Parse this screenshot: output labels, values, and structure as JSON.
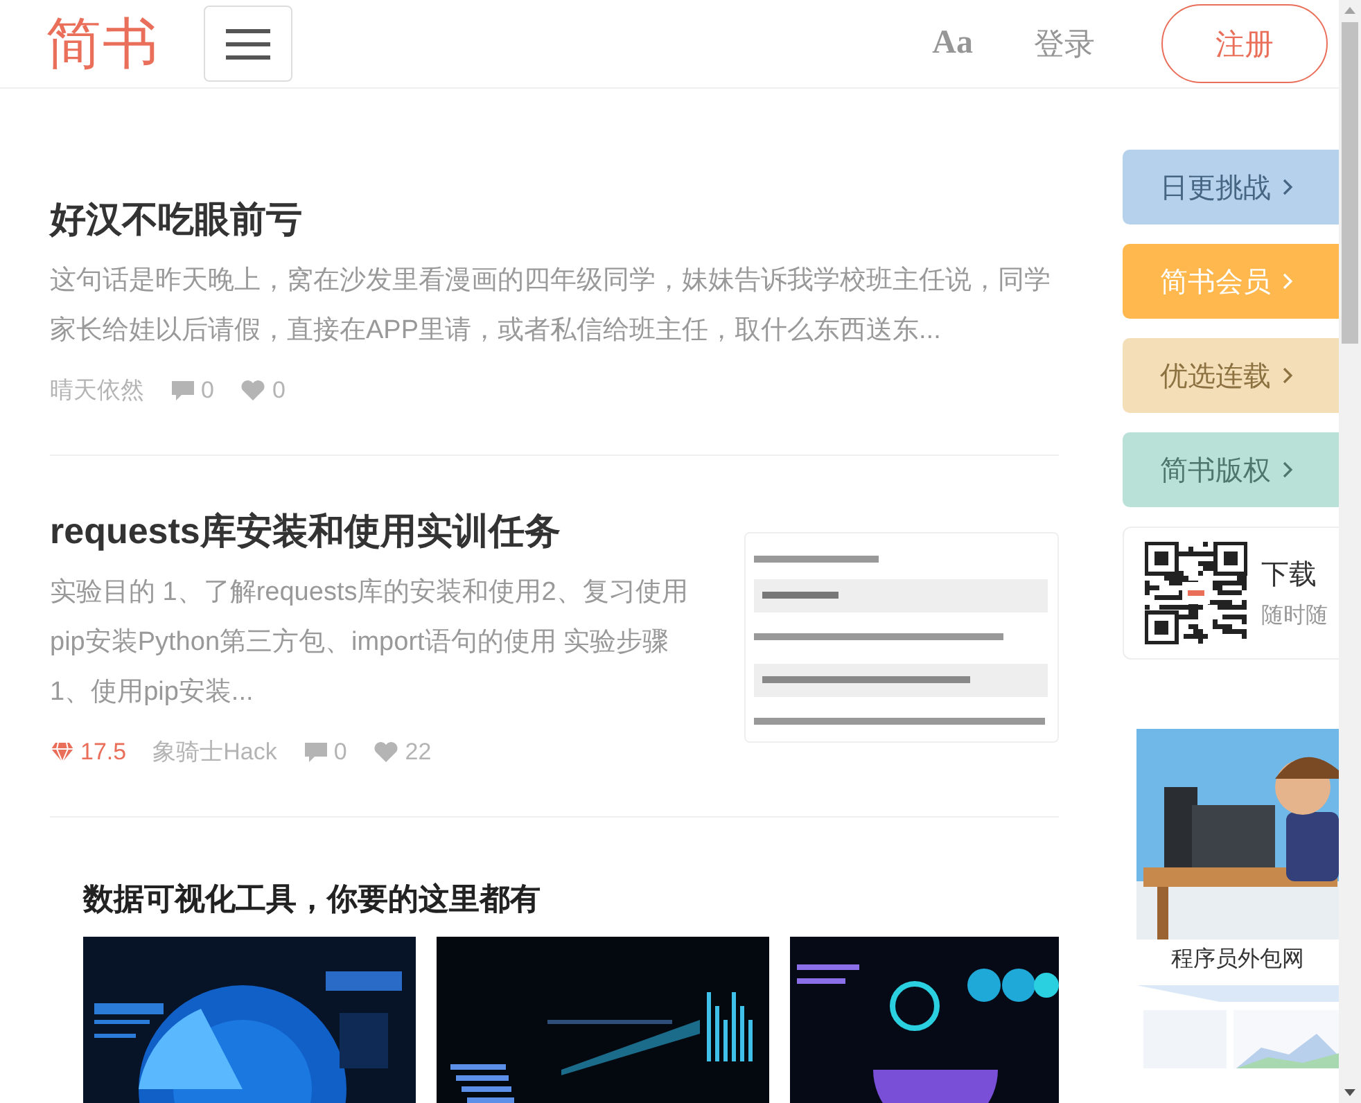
{
  "header": {
    "logo": "简书",
    "font_button": "Aa",
    "login": "登录",
    "signup": "注册"
  },
  "articles": [
    {
      "title": "好汉不吃眼前亏",
      "summary": "这句话是昨天晚上，窝在沙发里看漫画的四年级同学，妹妹告诉我学校班主任说，同学家长给娃以后请假，直接在APP里请，或者私信给班主任，取什么东西送东...",
      "author": "晴天依然",
      "comments": "0",
      "likes": "0"
    },
    {
      "title": "requests库安装和使用实训任务",
      "summary": "实验目的 1、了解requests库的安装和使用2、复习使用pip安装Python第三方包、import语句的使用 实验步骤 1、使用pip安装...",
      "diamonds": "17.5",
      "author": "象骑士Hack",
      "comments": "0",
      "likes": "22",
      "thumbnail": {
        "kind": "picture"
      }
    }
  ],
  "ad": {
    "title": "数据可视化工具，你要的这里都有",
    "images": [
      {
        "kind": "picture"
      },
      {
        "kind": "picture"
      },
      {
        "kind": "picture"
      }
    ]
  },
  "sidebar": {
    "banners": [
      {
        "label": "日更挑战",
        "color": "#b5d1ec",
        "kind": "tint"
      },
      {
        "label": "简书会员",
        "color": "#ffb84d",
        "kind": "solid"
      },
      {
        "label": "优选连载",
        "color": "#f4deb8",
        "kind": "tint"
      },
      {
        "label": "简书版权",
        "color": "#b9e1d8",
        "kind": "tint"
      }
    ],
    "app_download": {
      "title": "下载",
      "subtitle": "随时随"
    },
    "ads": [
      {
        "kind": "picture",
        "caption": "程序员外包网"
      },
      {
        "kind": "picture"
      }
    ]
  }
}
